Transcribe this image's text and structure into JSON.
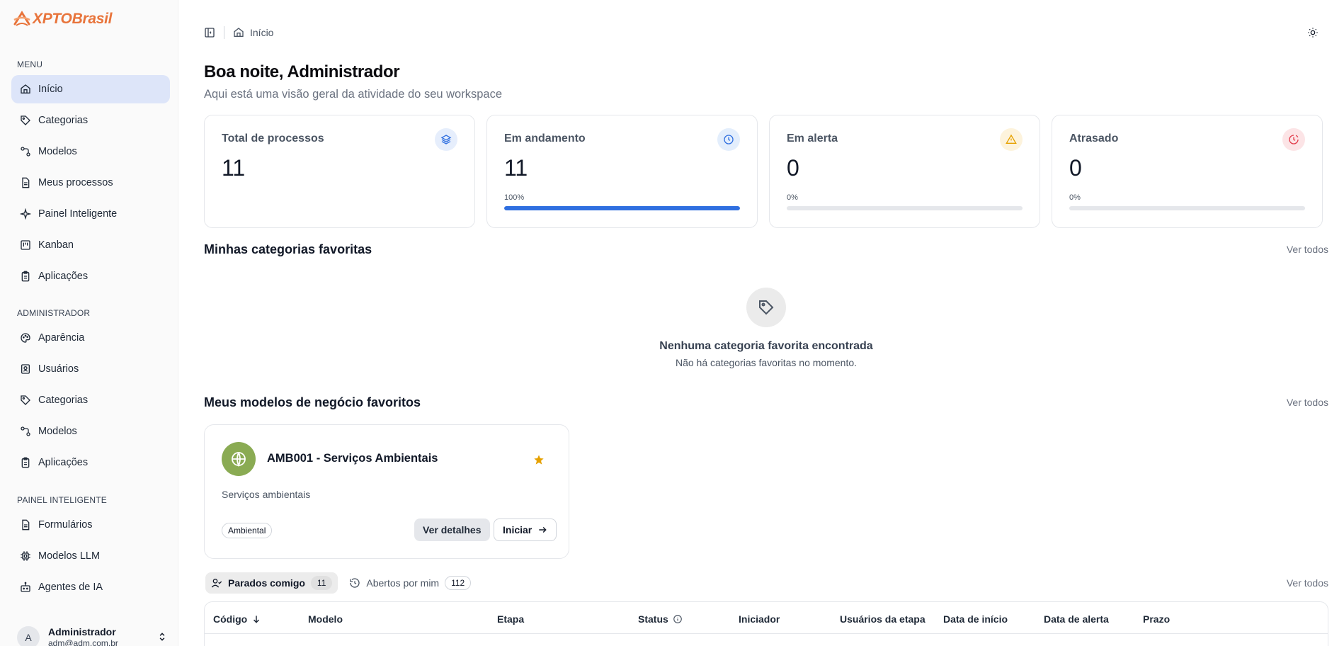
{
  "brand": {
    "name": "XPTOBrasil",
    "accent": "#e8743b"
  },
  "sidebar": {
    "menu_label": "MENU",
    "menu_items": [
      {
        "label": "Início",
        "icon": "home-icon",
        "active": true
      },
      {
        "label": "Categorias",
        "icon": "tag-icon"
      },
      {
        "label": "Modelos",
        "icon": "workflow-icon"
      },
      {
        "label": "Meus processos",
        "icon": "file-text-icon"
      },
      {
        "label": "Painel Inteligente",
        "icon": "sparkles-icon"
      },
      {
        "label": "Kanban",
        "icon": "kanban-icon"
      },
      {
        "label": "Aplicações",
        "icon": "clipboard-icon"
      }
    ],
    "admin_label": "ADMINISTRADOR",
    "admin_items": [
      {
        "label": "Aparência",
        "icon": "palette-icon"
      },
      {
        "label": "Usuários",
        "icon": "user-badge-icon"
      },
      {
        "label": "Categorias",
        "icon": "tag-icon"
      },
      {
        "label": "Modelos",
        "icon": "workflow-icon"
      },
      {
        "label": "Aplicações",
        "icon": "clipboard-icon"
      }
    ],
    "smart_label": "PAINEL INTELIGENTE",
    "smart_items": [
      {
        "label": "Formulários",
        "icon": "file-text-icon"
      },
      {
        "label": "Modelos LLM",
        "icon": "cpu-icon"
      },
      {
        "label": "Agentes de IA",
        "icon": "bot-icon"
      }
    ],
    "user": {
      "initial": "A",
      "name": "Administrador",
      "email": "adm@adm.com.br"
    }
  },
  "topbar": {
    "breadcrumb": "Início"
  },
  "header": {
    "title": "Boa noite, Administrador",
    "subtitle": "Aqui está uma visão geral da atividade do seu workspace"
  },
  "stats": [
    {
      "label": "Total de processos",
      "value": "11",
      "icon": "layers-icon",
      "icon_color": "#2f6fe0",
      "icon_bg": "#e6eefc"
    },
    {
      "label": "Em andamento",
      "value": "11",
      "pct_label": "100%",
      "progress": 100,
      "icon": "clock-icon",
      "icon_color": "#2f6fe0",
      "icon_bg": "#e3eefc"
    },
    {
      "label": "Em alerta",
      "value": "0",
      "pct_label": "0%",
      "progress": 0,
      "icon": "alert-triangle-icon",
      "icon_color": "#e6a100",
      "icon_bg": "#fdf3dc"
    },
    {
      "label": "Atrasado",
      "value": "0",
      "pct_label": "0%",
      "progress": 0,
      "icon": "clock-alert-icon",
      "icon_color": "#e23b4a",
      "icon_bg": "#fce4e6"
    }
  ],
  "favorites_categories": {
    "title": "Minhas categorias favoritas",
    "see_all": "Ver todos",
    "empty_title": "Nenhuma categoria favorita encontrada",
    "empty_sub": "Não há categorias favoritas no momento."
  },
  "favorites_models": {
    "title": "Meus modelos de negócio favoritos",
    "see_all": "Ver todos",
    "card": {
      "title": "AMB001 - Serviços Ambientais",
      "description": "Serviços ambientais",
      "tag": "Ambiental",
      "details_label": "Ver detalhes",
      "start_label": "Iniciar",
      "avatar_color": "#8aab53",
      "star_color": "#e6a100"
    }
  },
  "process_tabs": {
    "tabs": [
      {
        "label": "Parados comigo",
        "count": "11",
        "active": true
      },
      {
        "label": "Abertos por mim",
        "count": "112"
      }
    ],
    "see_all": "Ver todos"
  },
  "table": {
    "columns": [
      "Código",
      "Modelo",
      "Etapa",
      "Status",
      "Iniciador",
      "Usuários da etapa",
      "Data de início",
      "Data de alerta",
      "Prazo"
    ]
  }
}
